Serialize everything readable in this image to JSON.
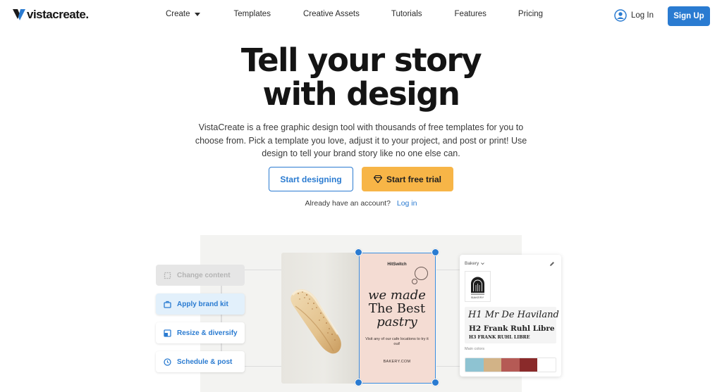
{
  "nav": {
    "brand": "vistacreate",
    "items": [
      "Create",
      "Templates",
      "Creative Assets",
      "Tutorials",
      "Features",
      "Pricing"
    ],
    "login": "Log In",
    "signup": "Sign Up"
  },
  "hero": {
    "title_line1": "Tell your story",
    "title_line2": "with design",
    "subtitle": "VistaCreate is a free graphic design tool with thousands of free templates for you to choose from. Pick a template you love, adjust it to your project, and post or print! Use design to tell your brand story like no one else can.",
    "btn_design": "Start designing",
    "btn_trial": "Start free trial",
    "account_text": "Already have an account?",
    "account_link": "Log in"
  },
  "illustration": {
    "steps": [
      "Change content",
      "Apply brand kit",
      "Resize & diversify",
      "Schedule & post"
    ],
    "poster": {
      "brand": "HitSwitch",
      "line1": "we made",
      "line2": "The Best",
      "line3": "pastry",
      "visit": "Visit any of our cafe locations to try it out!",
      "url": "BAKERY.COM"
    },
    "brand_panel": {
      "title": "Bakery",
      "logo_text": "BAKERY",
      "h1": "H1 Mr De Haviland",
      "h2": "H2 Frank Ruhl Libre",
      "h3": "H3 FRANK RUHL LIBRE",
      "colors_label": "Main colors",
      "colors": [
        "#8ec3d2",
        "#d2b387",
        "#b55a55",
        "#8a2a2a",
        "#ffffff"
      ]
    }
  },
  "theme": {
    "accent": "#2a7bd1",
    "trial": "#f7b547"
  }
}
